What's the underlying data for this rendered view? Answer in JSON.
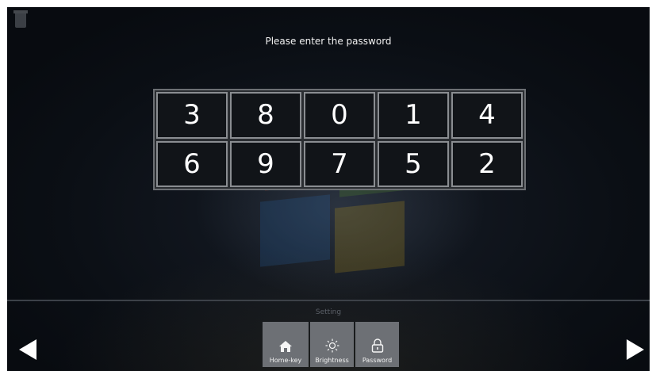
{
  "prompt": "Please enter the password",
  "keypad": {
    "rows": [
      [
        "3",
        "8",
        "0",
        "1",
        "4"
      ],
      [
        "6",
        "9",
        "7",
        "5",
        "2"
      ]
    ]
  },
  "toolbar": {
    "section_label": "Setting",
    "buttons": [
      {
        "label": "Home-key",
        "icon": "home-icon"
      },
      {
        "label": "Brightness",
        "icon": "brightness-icon"
      },
      {
        "label": "Password",
        "icon": "lock-icon"
      }
    ]
  },
  "nav": {
    "prev_icon": "left-arrow-icon",
    "next_icon": "right-arrow-icon"
  },
  "colors": {
    "background": "#0b0f15",
    "key_border": "#8a8d91",
    "tool_bg": "#6d7075"
  }
}
